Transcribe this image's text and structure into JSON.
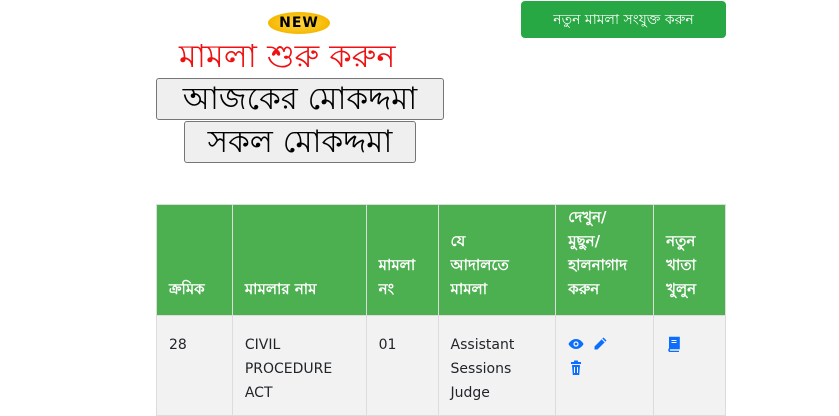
{
  "badge": {
    "text": "NEW"
  },
  "add_case_button": {
    "label": "নতুন মামলা সংযুক্ত করুন"
  },
  "start_case_link": {
    "label": "মামলা শুরু করুন"
  },
  "today_cases_button": {
    "label": "আজকের মোকদ্দমা"
  },
  "all_cases_button": {
    "label": "সকল মোকদ্দমা"
  },
  "table": {
    "headers": [
      "ক্রমিক",
      "মামলার নাম",
      "মামলা নং",
      "যে আদালতে মামলা",
      "দেখুন/মুছুন/হালনাগাদ করুন",
      "নতুন খাতা খুলুন"
    ],
    "header_lines": [
      [
        "ক্রমিক"
      ],
      [
        "মামলার নাম"
      ],
      [
        "মামলা",
        "নং"
      ],
      [
        "যে",
        "আদালতে",
        "মামলা"
      ],
      [
        "দেখুন/",
        "মুছুন/",
        "হালনাগাদ",
        "করুন"
      ],
      [
        "নতুন",
        "খাতা",
        "খুলুন"
      ]
    ],
    "rows": [
      {
        "serial": "28",
        "case_name_lines": [
          "CIVIL",
          "PROCEDURE",
          "ACT"
        ],
        "case_no": "01",
        "court_lines": [
          "Assistant",
          "Sessions",
          "Judge"
        ]
      }
    ]
  },
  "colors": {
    "header_green": "#4caf50",
    "button_green": "#28a745",
    "start_red": "#ee1111",
    "icon_blue": "#0d6efd",
    "row_bg": "#f2f2f2"
  },
  "icons": [
    "eye-icon",
    "pencil-icon",
    "trash-icon",
    "book-icon"
  ]
}
